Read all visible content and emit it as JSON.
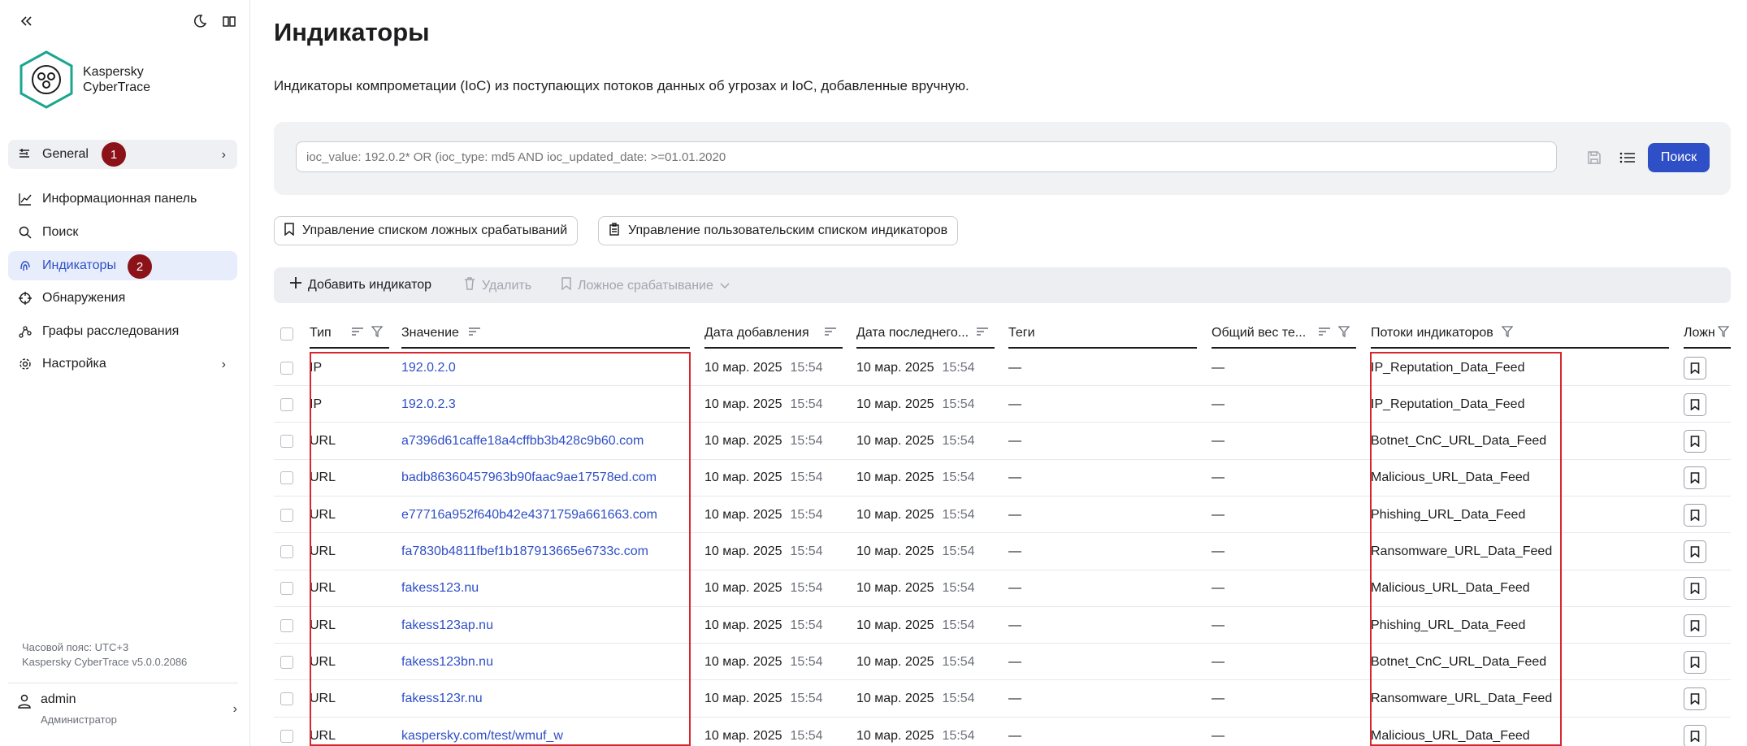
{
  "sidebar": {
    "logo_line1": "Kaspersky",
    "logo_line2": "CyberTrace",
    "general_label": "General",
    "badge1": "1",
    "badge2": "2",
    "items": [
      {
        "label": "Информационная панель",
        "icon": "chart-line-icon"
      },
      {
        "label": "Поиск",
        "icon": "search-icon"
      },
      {
        "label": "Индикаторы",
        "icon": "fingerprint-icon",
        "active": true
      },
      {
        "label": "Обнаружения",
        "icon": "crosshair-icon"
      },
      {
        "label": "Графы расследования",
        "icon": "graph-icon"
      },
      {
        "label": "Настройка",
        "icon": "gear-icon"
      }
    ],
    "timezone": "Часовой пояс: UTC+3",
    "version": "Kaspersky CyberTrace v5.0.0.2086",
    "user_name": "admin",
    "user_role": "Администратор"
  },
  "page": {
    "title": "Индикаторы",
    "description": "Индикаторы компрометации (IoC) из поступающих потоков данных об угрозах и IoC, добавленные вручную."
  },
  "search": {
    "placeholder": "ioc_value: 192.0.2* OR (ioc_type: md5 AND ioc_updated_date: >=01.01.2020",
    "button_label": "Поиск"
  },
  "actions": {
    "false_positives_label": "Управление списком ложных срабатываний",
    "custom_list_label": "Управление пользовательским списком индикаторов"
  },
  "toolbar": {
    "add_label": "Добавить индикатор",
    "delete_label": "Удалить",
    "false_positive_label": "Ложное срабатывание"
  },
  "table": {
    "columns": {
      "type": "Тип",
      "value": "Значение",
      "added": "Дата добавления",
      "last": "Дата последнего...",
      "tags": "Теги",
      "weight": "Общий вес те...",
      "feeds": "Потоки индикаторов",
      "false": "Ложн"
    },
    "rows": [
      {
        "type": "IP",
        "value": "192.0.2.0",
        "added_date": "10 мар. 2025",
        "added_time": "15:54",
        "last_date": "10 мар. 2025",
        "last_time": "15:54",
        "tags": "—",
        "weight": "—",
        "feed": "IP_Reputation_Data_Feed"
      },
      {
        "type": "IP",
        "value": "192.0.2.3",
        "added_date": "10 мар. 2025",
        "added_time": "15:54",
        "last_date": "10 мар. 2025",
        "last_time": "15:54",
        "tags": "—",
        "weight": "—",
        "feed": "IP_Reputation_Data_Feed"
      },
      {
        "type": "URL",
        "value": "a7396d61caffe18a4cffbb3b428c9b60.com",
        "added_date": "10 мар. 2025",
        "added_time": "15:54",
        "last_date": "10 мар. 2025",
        "last_time": "15:54",
        "tags": "—",
        "weight": "—",
        "feed": "Botnet_CnC_URL_Data_Feed"
      },
      {
        "type": "URL",
        "value": "badb86360457963b90faac9ae17578ed.com",
        "added_date": "10 мар. 2025",
        "added_time": "15:54",
        "last_date": "10 мар. 2025",
        "last_time": "15:54",
        "tags": "—",
        "weight": "—",
        "feed": "Malicious_URL_Data_Feed"
      },
      {
        "type": "URL",
        "value": "e77716a952f640b42e4371759a661663.com",
        "added_date": "10 мар. 2025",
        "added_time": "15:54",
        "last_date": "10 мар. 2025",
        "last_time": "15:54",
        "tags": "—",
        "weight": "—",
        "feed": "Phishing_URL_Data_Feed"
      },
      {
        "type": "URL",
        "value": "fa7830b4811fbef1b187913665e6733c.com",
        "added_date": "10 мар. 2025",
        "added_time": "15:54",
        "last_date": "10 мар. 2025",
        "last_time": "15:54",
        "tags": "—",
        "weight": "—",
        "feed": "Ransomware_URL_Data_Feed"
      },
      {
        "type": "URL",
        "value": "fakess123.nu",
        "added_date": "10 мар. 2025",
        "added_time": "15:54",
        "last_date": "10 мар. 2025",
        "last_time": "15:54",
        "tags": "—",
        "weight": "—",
        "feed": "Malicious_URL_Data_Feed"
      },
      {
        "type": "URL",
        "value": "fakess123ap.nu",
        "added_date": "10 мар. 2025",
        "added_time": "15:54",
        "last_date": "10 мар. 2025",
        "last_time": "15:54",
        "tags": "—",
        "weight": "—",
        "feed": "Phishing_URL_Data_Feed"
      },
      {
        "type": "URL",
        "value": "fakess123bn.nu",
        "added_date": "10 мар. 2025",
        "added_time": "15:54",
        "last_date": "10 мар. 2025",
        "last_time": "15:54",
        "tags": "—",
        "weight": "—",
        "feed": "Botnet_CnC_URL_Data_Feed"
      },
      {
        "type": "URL",
        "value": "fakess123r.nu",
        "added_date": "10 мар. 2025",
        "added_time": "15:54",
        "last_date": "10 мар. 2025",
        "last_time": "15:54",
        "tags": "—",
        "weight": "—",
        "feed": "Ransomware_URL_Data_Feed"
      },
      {
        "type": "URL",
        "value": "kaspersky.com/test/wmuf_w",
        "added_date": "10 мар. 2025",
        "added_time": "15:54",
        "last_date": "10 мар. 2025",
        "last_time": "15:54",
        "tags": "—",
        "weight": "—",
        "feed": "Malicious_URL_Data_Feed"
      }
    ]
  },
  "colors": {
    "accent": "#2f4fc7",
    "badge": "#8b1218",
    "highlight_box": "#d9262e",
    "logo_teal": "#1aa68f"
  }
}
